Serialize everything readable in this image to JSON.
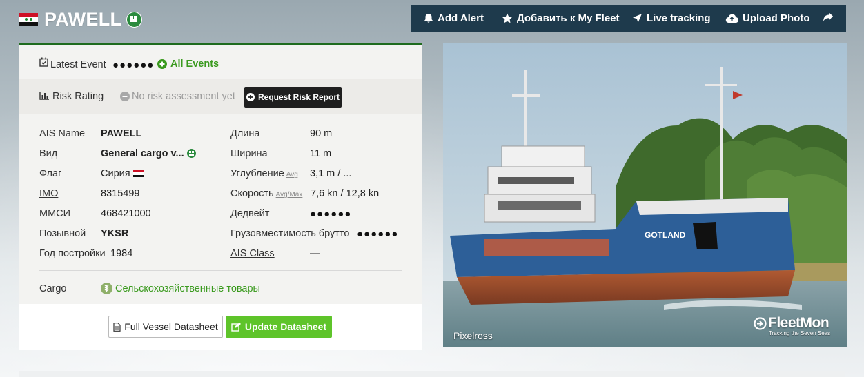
{
  "vessel": {
    "name": "PAWELL",
    "flag_country": "Сирия",
    "type_icon": "general-cargo-icon"
  },
  "toolbar": {
    "add_alert": "Add Alert",
    "add_fleet": "Добавить к My Fleet",
    "live_tracking": "Live tracking",
    "upload_photo": "Upload Photo",
    "share_icon": "share-icon"
  },
  "events": {
    "latest_label": "Latest Event",
    "latest_value": "●●●●●●",
    "all_events": "All Events"
  },
  "risk": {
    "label": "Risk Rating",
    "status": "No risk assessment yet",
    "button": "Request Risk Report"
  },
  "details": {
    "left": [
      {
        "label": "AIS Name",
        "value": "PAWELL"
      },
      {
        "label": "Вид",
        "value": "General cargo v..."
      },
      {
        "label": "Флаг",
        "value": "Сирия"
      },
      {
        "label": "IMO",
        "value": "8315499"
      },
      {
        "label": "MMCИ",
        "value": "468421000"
      },
      {
        "label": "Позывной",
        "value": "YKSR"
      },
      {
        "label": "Год постройки",
        "value": "1984"
      }
    ],
    "right": [
      {
        "label": "Длина",
        "value": "90 m"
      },
      {
        "label": "Ширина",
        "value": "11 m"
      },
      {
        "label": "Углубление",
        "sub": "Avg",
        "value": "3,1 m / ..."
      },
      {
        "label": "Скорость",
        "sub": "Avg/Max",
        "value": "7,6 kn / 12,8 kn"
      },
      {
        "label": "Дедвейт",
        "value": "●●●●●●"
      },
      {
        "label": "Грузовместимость брутто",
        "value": "●●●●●●"
      },
      {
        "label": "AIS Class",
        "value": "—"
      }
    ],
    "cargo_label": "Cargo",
    "cargo_value": "Сельскохозяйственные товары"
  },
  "actions": {
    "full_datasheet": "Full Vessel Datasheet",
    "update_datasheet": "Update Datasheet"
  },
  "photo": {
    "credit": "Pixelross",
    "brand": "FleetMon",
    "tagline": "Tracking the Seven Seas",
    "ship_name_on_hull": "GOTLAND"
  },
  "colors": {
    "toolbar_bg": "#1e3a4c",
    "panel_accent": "#1e6b1e",
    "link_green": "#3a9a1e",
    "update_btn": "#5ec42a"
  }
}
